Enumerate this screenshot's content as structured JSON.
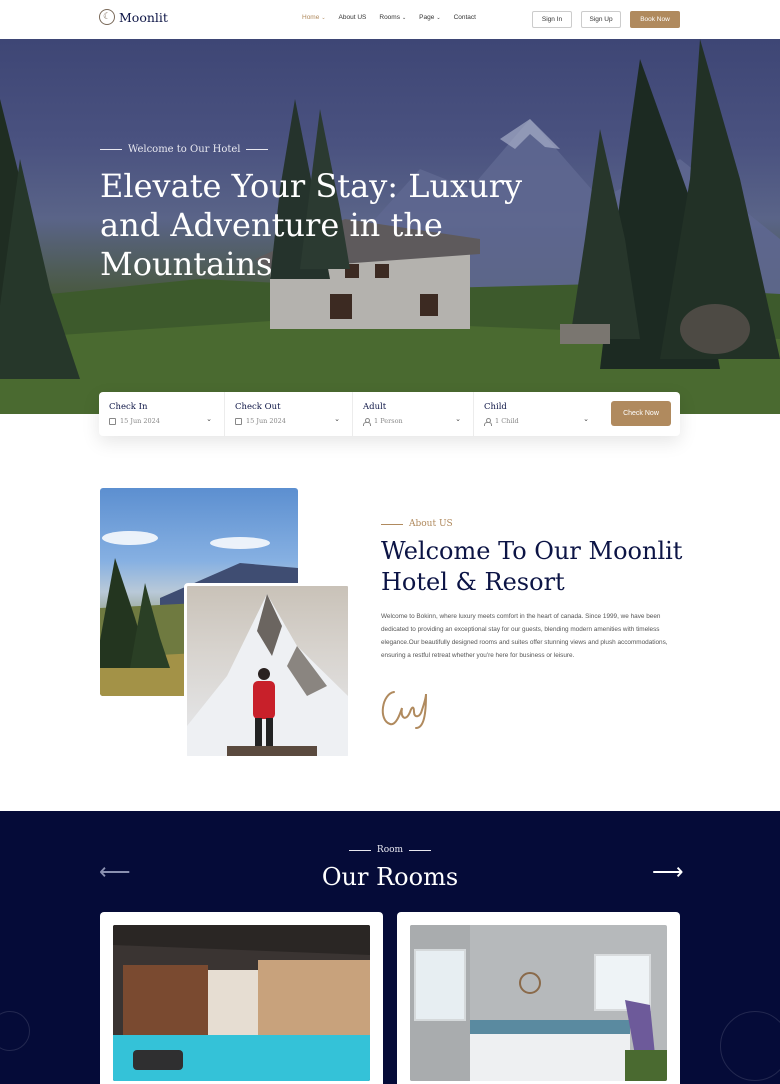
{
  "nav": {
    "logo_text": "Moonlit",
    "menu": [
      {
        "label": "Home",
        "active": true,
        "dropdown": true
      },
      {
        "label": "About US",
        "active": false,
        "dropdown": false
      },
      {
        "label": "Rooms",
        "active": false,
        "dropdown": true
      },
      {
        "label": "Page",
        "active": false,
        "dropdown": true
      },
      {
        "label": "Contact",
        "active": false,
        "dropdown": false
      }
    ],
    "sign_in": "Sign In",
    "sign_up": "Sign Up",
    "book_now": "Book Now"
  },
  "hero": {
    "tagline": "Welcome to Our Hotel",
    "title": "Elevate Your Stay: Luxury and Adventure in the Mountains"
  },
  "booking": {
    "check_in": {
      "label": "Check In",
      "value": "15 Jun 2024",
      "icon": "calendar-icon"
    },
    "check_out": {
      "label": "Check Out",
      "value": "15 Jun 2024",
      "icon": "calendar-icon"
    },
    "adult": {
      "label": "Adult",
      "value": "1 Person",
      "icon": "user-icon"
    },
    "child": {
      "label": "Child",
      "value": "1 Child",
      "icon": "user-icon"
    },
    "check_now": "Check Now"
  },
  "about": {
    "tag": "About US",
    "title": "Welcome To Our Moonlit Hotel & Resort",
    "text": "Welcome to Bokinn, where luxury meets comfort in the heart of canada. Since 1999, we have been dedicated to providing an exceptional stay for our guests, blending modern amenities with timeless elegance.Our beautifully designed rooms and suites offer stunning views and plush accommodations, ensuring a restful retreat whether you're here for business or leisure."
  },
  "rooms": {
    "tag": "Room",
    "title": "Our Rooms",
    "prev_icon": "arrow-left-icon",
    "next_icon": "arrow-right-icon"
  },
  "colors": {
    "accent": "#b08a5e",
    "navy": "#0c1445",
    "rooms_bg": "#050b38"
  }
}
